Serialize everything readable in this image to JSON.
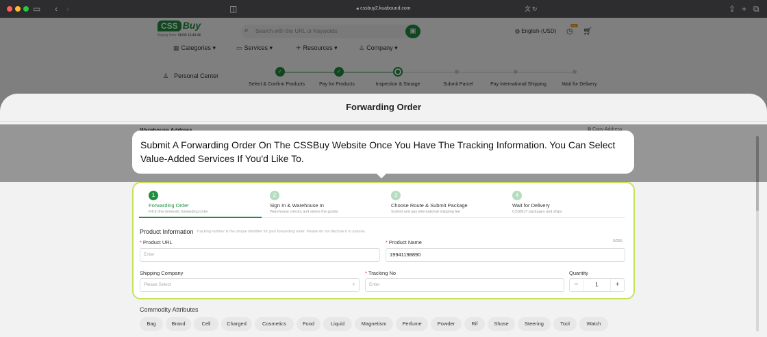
{
  "browser": {
    "url": "cssbuy2.kuabound.com"
  },
  "site": {
    "logo_box": "CSS",
    "logo_buy": "Buy",
    "beijing_label": "Beijing Time:",
    "beijing_time": "06/09 16:49:46",
    "search_placeholder": "Search with the URL or Keywords",
    "language": "English-(USD)",
    "cart_badge": "99+",
    "nav": {
      "categories": "Categories",
      "services": "Services",
      "resources": "Resources",
      "company": "Company"
    },
    "personal_center": "Personal Center",
    "progress": {
      "steps": [
        "Select & Confirm Products",
        "Pay for Products",
        "Inspection & Storage",
        "Submit Parcel",
        "Pay International Shipping",
        "Wait for Delivery"
      ]
    }
  },
  "modal": {
    "title": "Forwarding Order",
    "warehouse_address": "Warehouse Address",
    "copy_address": "Copy Address"
  },
  "tooltip": {
    "text": "Submit A Forwarding Order On The CSSBuy Website Once You Have The Tracking Information. You Can Select Value-Added Services If You'd Like To."
  },
  "form": {
    "steps": [
      {
        "num": "1",
        "title": "Forwarding Order",
        "desc": "Fill in the domestic forwarding order"
      },
      {
        "num": "2",
        "title": "Sign In & Warehouse In",
        "desc": "Warehouse checks and stores the goods"
      },
      {
        "num": "3",
        "title": "Choose Route & Submit Package",
        "desc": "Submit and pay international shipping fee"
      },
      {
        "num": "4",
        "title": "Wait for Delivery",
        "desc": "CSSBUY packages and ships"
      }
    ],
    "product_info": "Product Information",
    "product_info_note": "Tracking number is the unique identifier for your forwarding order. Please do not disclose it to anyone.",
    "product_url_label": "Product URL",
    "product_url_placeholder": "Enter",
    "product_name_label": "Product Name",
    "product_name_value": "19941198890",
    "product_name_counter": "0/255",
    "shipping_company_label": "Shipping Company",
    "shipping_company_placeholder": "Please Select",
    "tracking_label": "Tracking No",
    "tracking_placeholder": "Enter",
    "quantity_label": "Quantity",
    "quantity_value": "1",
    "required_mark": "*"
  },
  "commodity": {
    "title": "Commodity Attributes",
    "chips": [
      "Bag",
      "Brand",
      "Cell",
      "Charged",
      "Cosmetics",
      "Food",
      "Liquid",
      "Magnetism",
      "Perfume",
      "Powder",
      "Rif",
      "Shose",
      "Steering",
      "Tool",
      "Watch"
    ]
  }
}
